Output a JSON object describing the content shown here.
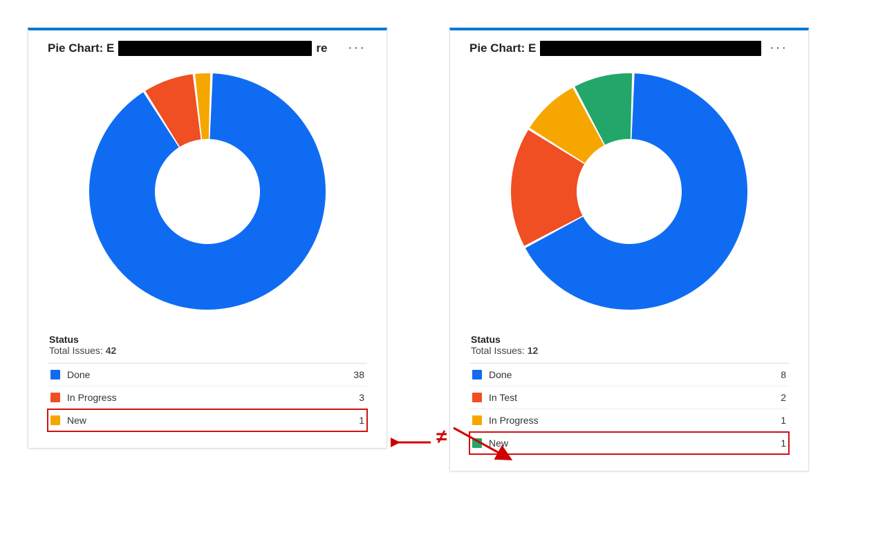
{
  "chart_data": [
    {
      "type": "pie",
      "title": "Pie Chart: E",
      "title_suffix": "re",
      "status_heading": "Status",
      "total_label": "Total Issues:",
      "total": 42,
      "series": [
        {
          "name": "Done",
          "value": 38,
          "color": "#0f6cf2"
        },
        {
          "name": "In Progress",
          "value": 3,
          "color": "#f04e23"
        },
        {
          "name": "New",
          "value": 1,
          "color": "#f5a700"
        }
      ],
      "highlight": "New"
    },
    {
      "type": "pie",
      "title": "Pie Chart: E",
      "title_suffix": "",
      "status_heading": "Status",
      "total_label": "Total Issues:",
      "total": 12,
      "series": [
        {
          "name": "Done",
          "value": 8,
          "color": "#0f6cf2"
        },
        {
          "name": "In Test",
          "value": 2,
          "color": "#f04e23"
        },
        {
          "name": "In Progress",
          "value": 1,
          "color": "#f5a700"
        },
        {
          "name": "New",
          "value": 1,
          "color": "#23a66a"
        }
      ],
      "highlight": "New"
    }
  ],
  "menu_glyph": "···",
  "annotation_symbol": "≠",
  "redaction_widths": [
    280,
    320
  ]
}
